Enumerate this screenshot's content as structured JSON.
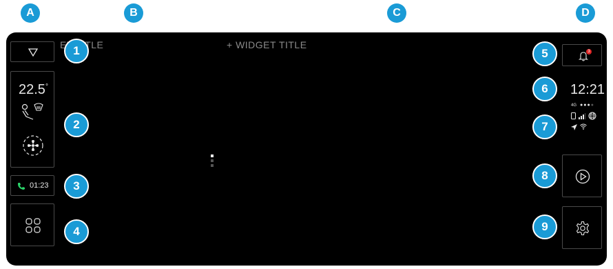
{
  "column_labels": [
    "A",
    "B",
    "C",
    "D"
  ],
  "callouts": [
    "1",
    "2",
    "3",
    "4",
    "5",
    "6",
    "7",
    "8",
    "9"
  ],
  "widget_titles": {
    "left_partial": "ET TITLE",
    "center": "+ WIDGET TITLE"
  },
  "climate": {
    "temperature": "22.5",
    "unit": "°"
  },
  "call": {
    "duration": "01:23"
  },
  "notifications": {
    "count": "3"
  },
  "status": {
    "time": "12:21",
    "network": "4G"
  },
  "page_indicator": {
    "pages": 3,
    "active": 0
  },
  "colors": {
    "badge": "#1a9bd6",
    "call_green": "#2bd66b",
    "notification_red": "#e02424",
    "background": "#000000"
  },
  "icons": [
    "chevron-down-icon",
    "seat-heat-icon",
    "defrost-icon",
    "fan-icon",
    "phone-icon",
    "apps-grid-icon",
    "bell-icon",
    "phone-device-icon",
    "signal-icon",
    "globe-icon",
    "location-arrow-icon",
    "wifi-icon",
    "play-icon",
    "gear-icon"
  ]
}
